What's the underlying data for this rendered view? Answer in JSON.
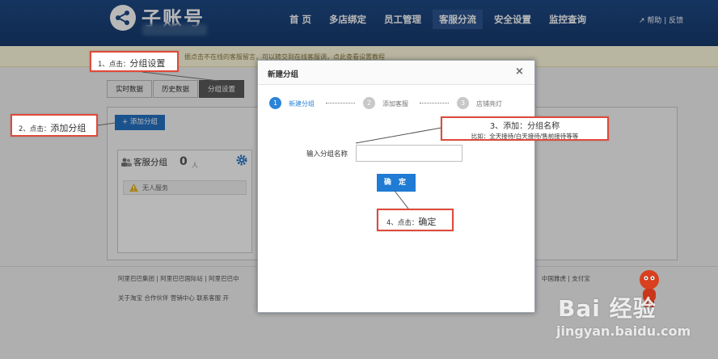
{
  "header": {
    "app_title": "子账号",
    "nav": [
      "首 页",
      "多店绑定",
      "员工管理",
      "客服分流",
      "安全设置",
      "监控查询"
    ],
    "active_nav": "客服分流",
    "help_link": "帮助 | 反馈",
    "brand_color": "#1e4a86"
  },
  "notice": {
    "text": "据点击不在线的客服留言，可以转交到在线客服调，点此查看设置教程"
  },
  "background": {
    "tabs": [
      "实时数据",
      "历史数据",
      "分组设置"
    ],
    "active_tab": "分组设置",
    "add_button": "+ 添加分组",
    "group_title": "客服分组",
    "group_count": "0",
    "group_unit": "人",
    "group_warning": "无人服务"
  },
  "footer": {
    "line1": "阿里巴巴集团 | 阿里巴巴国际站 | 阿里巴巴中",
    "line1_right": "中国雅虎 | 支付宝",
    "line2": "关于淘宝  合作伙伴  营销中心  联系客服  开"
  },
  "modal": {
    "title": "新建分组",
    "close_symbol": "×",
    "steps": [
      {
        "number": "1",
        "label": "新建分组",
        "active": true
      },
      {
        "number": "2",
        "label": "添加客服",
        "active": false
      },
      {
        "number": "3",
        "label": "店铺亮灯",
        "active": false
      }
    ],
    "field_label": "输入分组名称",
    "field_value": "",
    "confirm_button": "确 定",
    "accent_color": "#1f7bd4"
  },
  "annotations": {
    "step1_num": "1、点击：",
    "step1_text": "分组设置",
    "step2_num": "2、点击：",
    "step2_text": "添加分组",
    "step3_line1": "3、添加：分组名称",
    "step3_line2": "比如：全天接待/白天接待/售前接待等等",
    "step4_num": "4、点击：",
    "step4_text": "确定",
    "border_color": "#e04a3a"
  },
  "watermark": {
    "main": "Bai 经验",
    "sub": "jingyan.baidu.com"
  }
}
